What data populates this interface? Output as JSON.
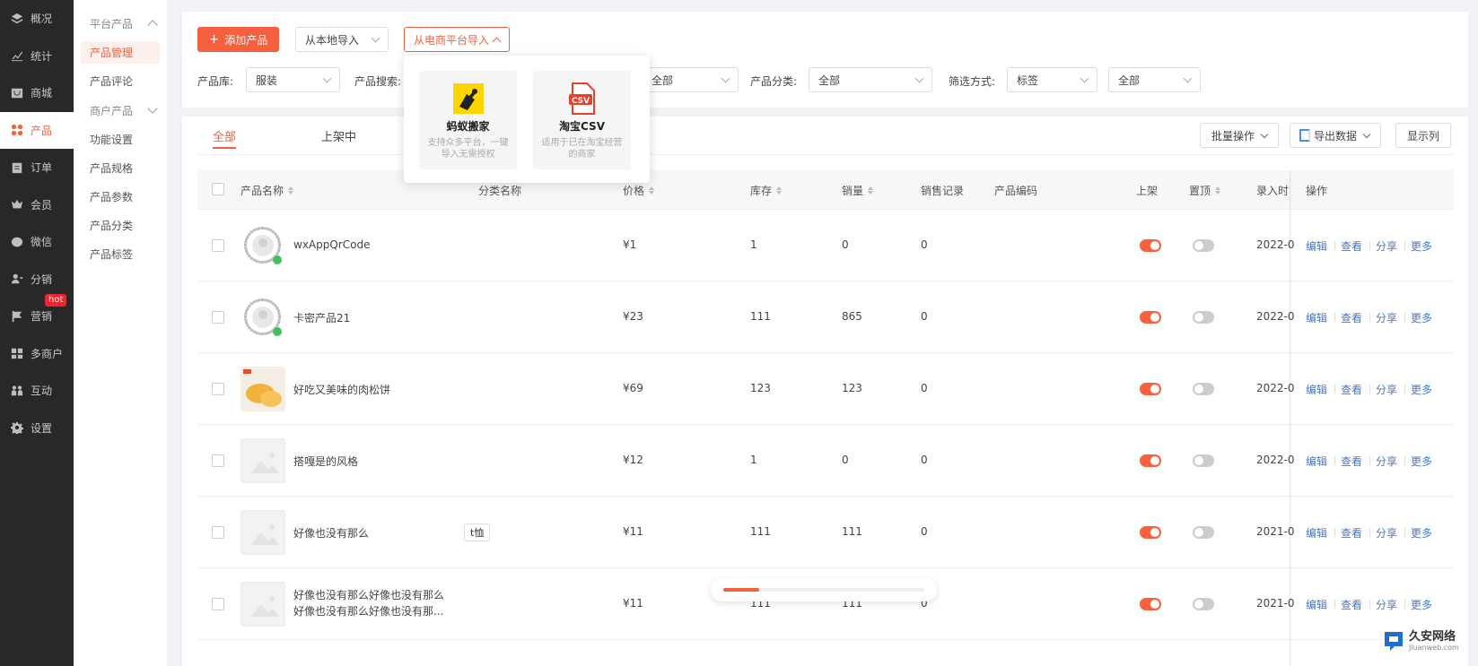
{
  "sidebar": {
    "items": [
      {
        "label": "概况",
        "icon": "layers-icon"
      },
      {
        "label": "统计",
        "icon": "chart-icon"
      },
      {
        "label": "商城",
        "icon": "shop-icon"
      },
      {
        "label": "产品",
        "icon": "grid-icon",
        "active": true
      },
      {
        "label": "订单",
        "icon": "clipboard-icon"
      },
      {
        "label": "会员",
        "icon": "crown-icon"
      },
      {
        "label": "微信",
        "icon": "wechat-icon"
      },
      {
        "label": "分销",
        "icon": "user-share-icon"
      },
      {
        "label": "营销",
        "icon": "flag-icon",
        "badge": "hot"
      },
      {
        "label": "多商户",
        "icon": "store-icon"
      },
      {
        "label": "互动",
        "icon": "people-icon"
      },
      {
        "label": "设置",
        "icon": "gear-icon"
      }
    ]
  },
  "subnav": {
    "group1": "平台产品",
    "items1": [
      "产品管理",
      "产品评论"
    ],
    "group2": "商户产品",
    "items2": [
      "功能设置",
      "产品规格",
      "产品参数",
      "产品分类",
      "产品标签"
    ]
  },
  "toolbar": {
    "add_label": "添加产品",
    "local_import": "从本地导入",
    "platform_import": "从电商平台导入"
  },
  "filters": {
    "library_label": "产品库:",
    "library_value": "服装",
    "search_label": "产品搜索:",
    "hidden_value": "全部",
    "category_label": "产品分类:",
    "category_value": "全部",
    "method_label": "筛选方式:",
    "method_value": "标签",
    "method_value2": "全部"
  },
  "import_popup": {
    "options": [
      {
        "title": "蚂蚁搬家",
        "desc": "支持众多平台，一键导入无需授权",
        "icon": "ant-mover-icon"
      },
      {
        "title": "淘宝CSV",
        "desc": "适用于已在淘宝经营的商家",
        "icon": "csv-file-icon"
      }
    ]
  },
  "tabs": [
    "全部",
    "上架中"
  ],
  "table_actions": {
    "batch": "批量操作",
    "export": "导出数据",
    "display": "显示列"
  },
  "table": {
    "headers": {
      "name": "产品名称",
      "category": "分类名称",
      "price": "价格",
      "stock": "库存",
      "sales": "销量",
      "sales_record": "销售记录",
      "code": "产品编码",
      "listed": "上架",
      "top": "置顶",
      "entry_time": "录入时",
      "ops": "操作"
    },
    "actions": [
      "编辑",
      "查看",
      "分享",
      "更多"
    ],
    "rows": [
      {
        "name": "wxAppQrCode",
        "name2": "",
        "tag": "",
        "price": "¥1",
        "stock": "1",
        "sales": "0",
        "record": "0",
        "date": "2022-0",
        "thumb": "qr",
        "listed": true,
        "top": false
      },
      {
        "name": "卡密产品21",
        "name2": "",
        "tag": "",
        "price": "¥23",
        "stock": "111",
        "sales": "865",
        "record": "0",
        "date": "2022-0",
        "thumb": "qr",
        "listed": true,
        "top": false
      },
      {
        "name": "好吃又美味的肉松饼",
        "name2": "",
        "tag": "",
        "price": "¥69",
        "stock": "123",
        "sales": "123",
        "record": "0",
        "date": "2022-0",
        "thumb": "food",
        "listed": true,
        "top": false
      },
      {
        "name": "搭嘎是的风格",
        "name2": "",
        "tag": "",
        "price": "¥12",
        "stock": "1",
        "sales": "0",
        "record": "0",
        "date": "2022-0",
        "thumb": "empty",
        "listed": true,
        "top": false
      },
      {
        "name": "好像也没有那么",
        "name2": "",
        "tag": "t恤",
        "price": "¥11",
        "stock": "111",
        "sales": "111",
        "record": "0",
        "date": "2021-0",
        "thumb": "empty",
        "listed": true,
        "top": false
      },
      {
        "name": "好像也没有那么好像也没有那么",
        "name2": "好像也没有那么好像也没有那...",
        "tag": "",
        "price": "¥11",
        "stock": "111",
        "sales": "111",
        "record": "0",
        "date": "2021-0",
        "thumb": "empty",
        "listed": true,
        "top": false
      }
    ]
  },
  "progress": {
    "value": 0.18
  },
  "watermark": {
    "line1": "久安网络",
    "line2": "Jiuanweb.com"
  },
  "colors": {
    "accent": "#f5603f",
    "link": "#4a78c8",
    "sidebar": "#282828"
  }
}
